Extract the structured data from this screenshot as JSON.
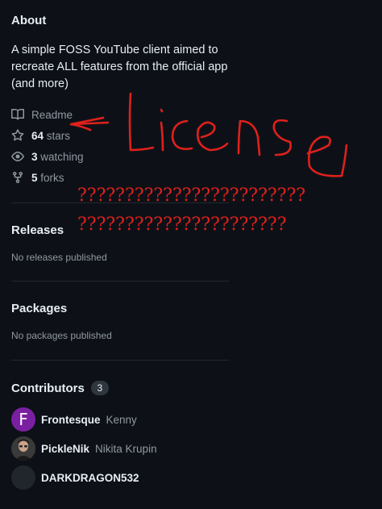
{
  "about": {
    "title": "About",
    "description": "A simple FOSS YouTube client aimed to recreate ALL features from the official app (and more)",
    "readme_label": "Readme",
    "stars_count": "64",
    "stars_label": "stars",
    "watching_count": "3",
    "watching_label": "watching",
    "forks_count": "5",
    "forks_label": "forks"
  },
  "releases": {
    "title": "Releases",
    "empty_text": "No releases published"
  },
  "packages": {
    "title": "Packages",
    "empty_text": "No packages published"
  },
  "contributors": {
    "title": "Contributors",
    "count": "3",
    "items": [
      {
        "login": "Frontesque",
        "name": "Kenny",
        "avatar_letter": "F"
      },
      {
        "login": "PickleNik",
        "name": "Nikita Krupin"
      },
      {
        "login": "DARKDRAGON532",
        "name": ""
      }
    ]
  },
  "annotation": {
    "handwritten": "License",
    "question_line_1": "????????????????????????",
    "question_line_2": "??????????????????????",
    "color": "#e0201c"
  }
}
